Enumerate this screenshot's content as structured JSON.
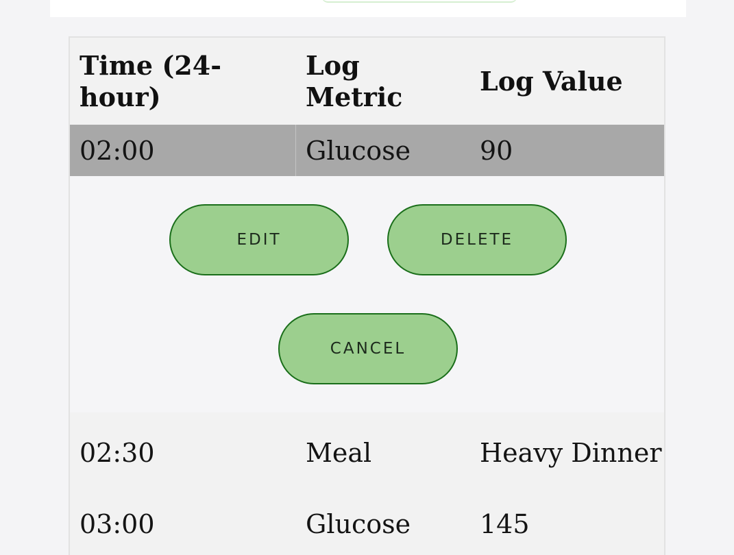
{
  "table": {
    "headers": {
      "time": "Time (24-hour)",
      "metric": "Log Metric",
      "value": "Log Value"
    },
    "rows": [
      {
        "time": "02:00",
        "metric": "Glucose",
        "value": "90",
        "selected": true
      },
      {
        "time": "02:30",
        "metric": "Meal",
        "value": "Heavy Dinner",
        "selected": false
      },
      {
        "time": "03:00",
        "metric": "Glucose",
        "value": "145",
        "selected": false
      }
    ]
  },
  "actions": {
    "edit_label": "EDIT",
    "delete_label": "DELETE",
    "cancel_label": "CANCEL"
  },
  "colors": {
    "button_fill": "#9ccf8e",
    "button_border": "#1a6e1a",
    "selected_row": "#a8a8a8",
    "background": "#f4f4f6"
  }
}
